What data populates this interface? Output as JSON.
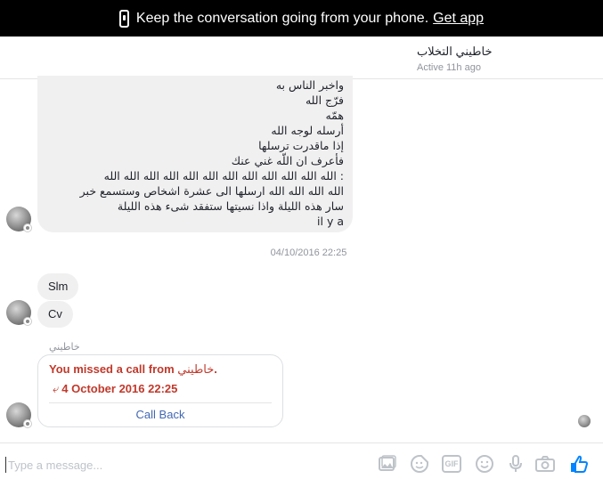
{
  "banner": {
    "text": "Keep the conversation going from your phone.",
    "link_label": "Get app"
  },
  "header": {
    "contact_name": "خاطيني التخلاب",
    "status": "Active 11h ago"
  },
  "messages": {
    "big_bubble_lines": [
      "واخبر الناس به",
      "فرّج الله",
      "همّه",
      "أرسله لوجه الله",
      "إذا ماقدرت ترسلها",
      "فأعرف ان اللّه غني عنك",
      ": الله الله الله الله الله الله الله الله الله الله الله الله",
      "الله الله الله الله ارسلها الى عشرة اشخاص وستسمع خبر",
      "سار هذه الليلة واذا نسيتها ستفقد شىء هذه الليلة",
      "il y a"
    ],
    "timestamp": "04/10/2016 22:25",
    "short_1": "Slm",
    "short_2": "Cv",
    "sender_label": "خاطيني"
  },
  "call": {
    "missed_prefix": "You missed a call from",
    "missed_name": "خاطيني",
    "missed_suffix": ".",
    "arrow": "⤶",
    "date": "4 October 2016 22:25",
    "callback_label": "Call Back"
  },
  "composer": {
    "placeholder": "Type a message..."
  },
  "colors": {
    "missed_call_red": "#c0392b",
    "link_blue": "#4267b2",
    "like_blue": "#0084ff",
    "bubble_gray": "#f1f0f0"
  },
  "icons": [
    "phone-icon",
    "image-icon",
    "sticker-icon",
    "gif-icon",
    "emoji-icon",
    "microphone-icon",
    "camera-icon",
    "thumbs-up-icon"
  ]
}
